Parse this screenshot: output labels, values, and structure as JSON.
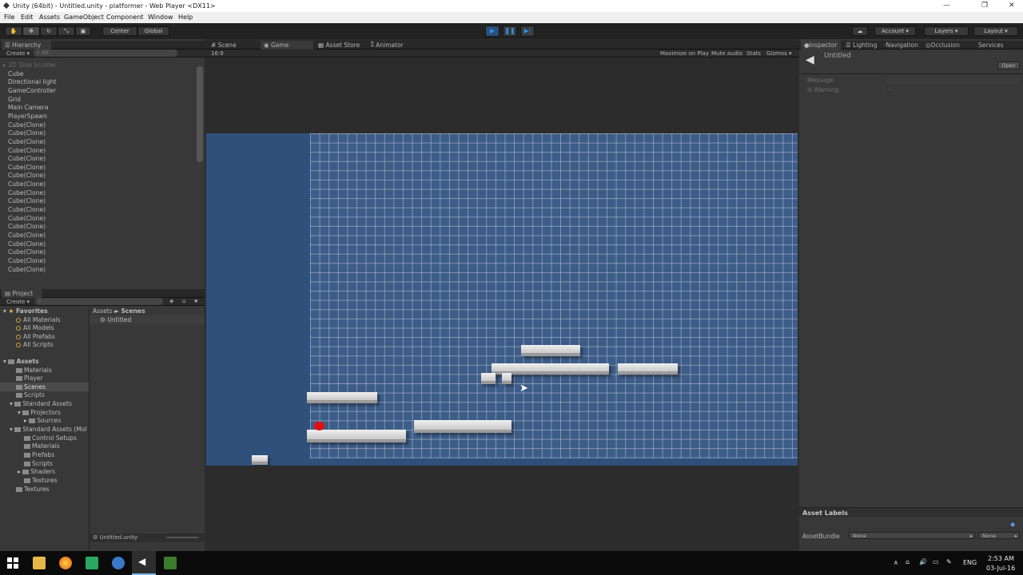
{
  "window": {
    "title": "Unity (64bit) - Untitled.unity - platformer - Web Player <DX11>"
  },
  "menu": [
    "File",
    "Edit",
    "Assets",
    "GameObject",
    "Component",
    "Window",
    "Help"
  ],
  "toolbar": {
    "pivot": "Center",
    "space": "Global",
    "account": "Account",
    "layers": "Layers",
    "layout": "Layout"
  },
  "hierarchy": {
    "tab": "Hierarchy",
    "create": "Create",
    "search": "All",
    "items": [
      "2D Side Scroller",
      "Cube",
      "Directional light",
      "GameController",
      "Grid",
      "Main Camera",
      "PlayerSpawn",
      "Cube(Clone)",
      "Cube(Clone)",
      "Cube(Clone)",
      "Cube(Clone)",
      "Cube(Clone)",
      "Cube(Clone)",
      "Cube(Clone)",
      "Cube(Clone)",
      "Cube(Clone)",
      "Cube(Clone)",
      "Cube(Clone)",
      "Cube(Clone)",
      "Cube(Clone)",
      "Cube(Clone)",
      "Cube(Clone)",
      "Cube(Clone)",
      "Cube(Clone)",
      "Cube(Clone)"
    ]
  },
  "center_tabs": {
    "scene": "Scene",
    "game": "Game",
    "asset_store": "Asset Store",
    "animator": "Animator"
  },
  "game_bar": {
    "aspect": "16:9",
    "maximize": "Maximize on Play",
    "mute": "Mute audio",
    "stats": "Stats",
    "gizmos": "Gizmos"
  },
  "project": {
    "tab": "Project",
    "create": "Create",
    "favorites_label": "Favorites",
    "favorites": [
      "All Materials",
      "All Models",
      "All Prefabs",
      "All Scripts"
    ],
    "assets_label": "Assets",
    "tree": [
      "Materials",
      "Player",
      "Scenes",
      "Scripts",
      "Standard Assets",
      "Projectors",
      "Sources",
      "Standard Assets (Mol",
      "Control Setups",
      "Materials",
      "Prefabs",
      "Scripts",
      "Shaders",
      "Textures",
      "Textures"
    ],
    "breadcrumb_root": "Assets",
    "breadcrumb_sep": "►",
    "breadcrumb_leaf": "Scenes",
    "file": "Untitled",
    "footer": "Untitled.unity"
  },
  "inspector": {
    "tabs": [
      "Inspector",
      "Lighting",
      "Navigation",
      "Occlusion",
      "Services"
    ],
    "object_name": "Untitled",
    "open": "Open",
    "fields": [
      "Message",
      "Is Warning"
    ],
    "asset_labels": "Asset Labels",
    "asset_bundle": "AssetBundle",
    "bundle_value": "None",
    "bundle_variant": "None"
  },
  "taskbar": {
    "lang": "ENG",
    "time": "2:53 AM",
    "date": "03-Jul-16"
  },
  "colors": {
    "game_bg": "#30507c",
    "grid": "#3d5d88",
    "play_blue": "#2f8fe8",
    "ball": "#e11010"
  }
}
